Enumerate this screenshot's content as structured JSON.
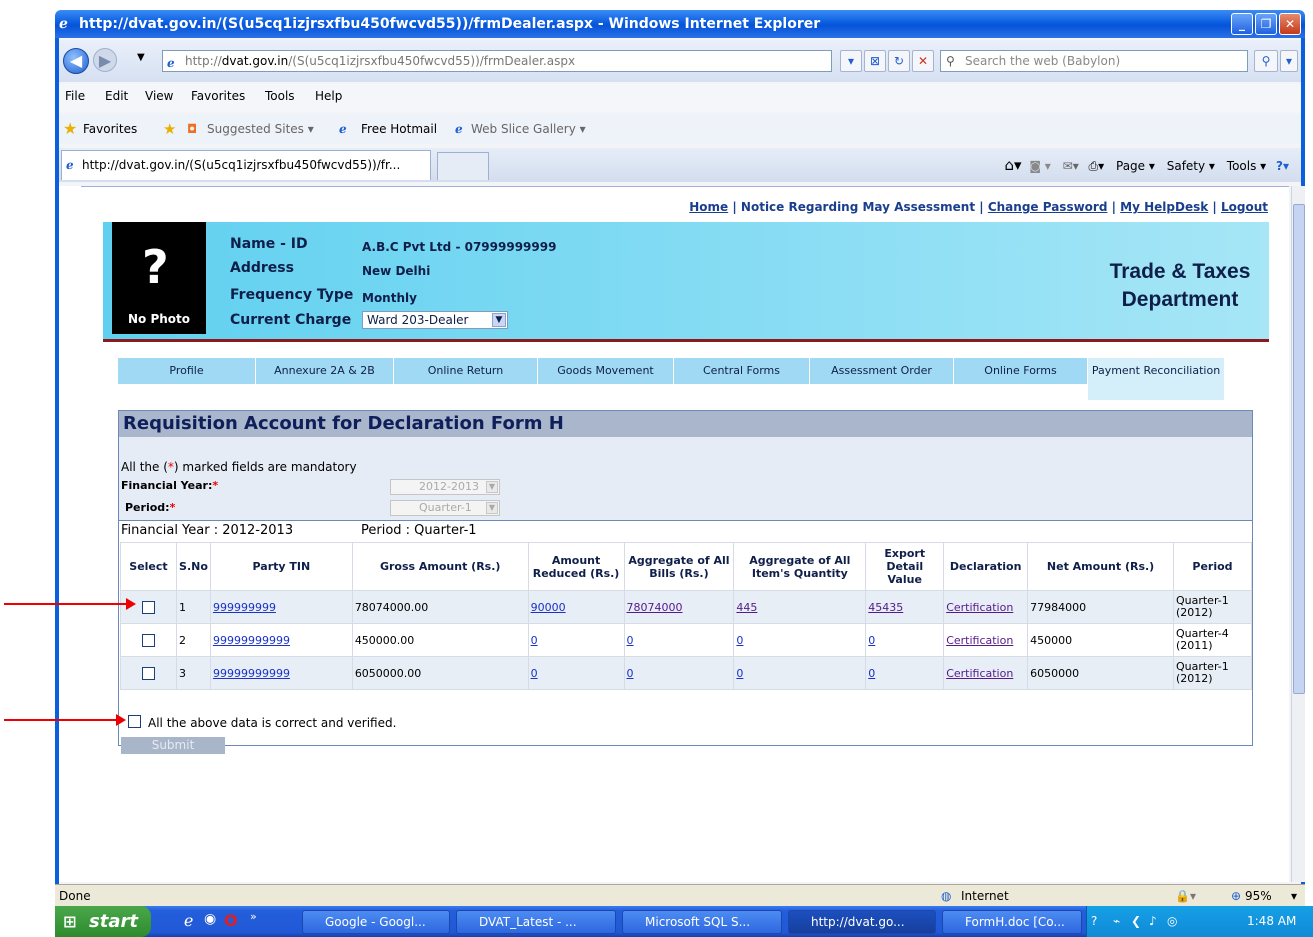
{
  "window": {
    "title": "http://dvat.gov.in/(S(u5cq1izjrsxfbu450fwcvd55))/frmDealer.aspx - Windows Internet Explorer"
  },
  "browser": {
    "address_prefix": "http://",
    "address_domain": "dvat.gov.in",
    "address_rest": "/(S(u5cq1izjrsxfbu450fwcvd55))/frmDealer.aspx",
    "search_placeholder": "Search the web (Babylon)",
    "menu": [
      "File",
      "Edit",
      "View",
      "Favorites",
      "Tools",
      "Help"
    ],
    "favorites": {
      "label": "Favorites",
      "suggested": "Suggested Sites ▾",
      "hotmail": "Free Hotmail",
      "webslice": "Web Slice Gallery ▾"
    },
    "tab_title": "http://dvat.gov.in/(S(u5cq1izjrsxfbu450fwcvd55))/fr...",
    "commands": {
      "page": "Page ▾",
      "safety": "Safety ▾",
      "tools": "Tools ▾"
    }
  },
  "page": {
    "toplinks": [
      "Home",
      "Notice Regarding May Assessment",
      "Change Password",
      "My HelpDesk",
      "Logout"
    ],
    "photo": {
      "mark": "?",
      "label": "No Photo"
    },
    "dealer": {
      "name_label": "Name - ID",
      "name_value": "A.B.C Pvt Ltd - 07999999999",
      "address_label": "Address",
      "address_value": "New Delhi",
      "frequency_label": "Frequency Type",
      "frequency_value": "Monthly",
      "charge_label": "Current Charge",
      "charge_value": "Ward 203-Dealer"
    },
    "department": "Trade & Taxes Department",
    "module_tabs": [
      "Profile",
      "Annexure 2A & 2B",
      "Online Return",
      "Goods Movement",
      "Central Forms",
      "Assessment Order",
      "Online Forms",
      "Payment Reconciliation"
    ],
    "form": {
      "title": "Requisition Account for Declaration Form H",
      "mandatory_note_pre": "All the (",
      "mandatory_star": "*",
      "mandatory_note_post": ") marked fields are mandatory",
      "fy_label": "Financial Year:",
      "fy_value": "2012-2013",
      "period_label": "Period:",
      "period_value": "Quarter-1",
      "summary_fy": "Financial Year : 2012-2013",
      "summary_period": "Period : Quarter-1"
    },
    "table": {
      "headers": [
        "Select",
        "S.No",
        "Party TIN",
        "Gross Amount (Rs.)",
        "Amount Reduced (Rs.)",
        "Aggregate of All Bills (Rs.)",
        "Aggregate of All Item's Quantity",
        "Export Detail Value",
        "Declaration",
        "Net Amount (Rs.)",
        "Period"
      ],
      "rows": [
        {
          "sno": "1",
          "tin": "999999999",
          "gross": "78074000.00",
          "reduced": "90000",
          "bills": "78074000",
          "qty": "445",
          "export": "45435",
          "decl": "Certification",
          "net": "77984000",
          "period": "Quarter-1 (2012)"
        },
        {
          "sno": "2",
          "tin": "99999999999",
          "gross": "450000.00",
          "reduced": "0",
          "bills": "0",
          "qty": "0",
          "export": "0",
          "decl": "Certification",
          "net": "450000",
          "period": "Quarter-4 (2011)"
        },
        {
          "sno": "3",
          "tin": "99999999999",
          "gross": "6050000.00",
          "reduced": "0",
          "bills": "0",
          "qty": "0",
          "export": "0",
          "decl": "Certification",
          "net": "6050000",
          "period": "Quarter-1 (2012)"
        }
      ]
    },
    "verify_text": "All the above data is correct and verified.",
    "submit_label": "Submit"
  },
  "status": {
    "left": "Done",
    "zone": "Internet",
    "zoom": "95%"
  },
  "taskbar": {
    "start": "start",
    "tasks": [
      "Google - Googl...",
      "DVAT_Latest - ...",
      "Microsoft SQL S...",
      "http://dvat.go...",
      "FormH.doc [Co..."
    ],
    "clock": "1:48 AM"
  },
  "colors": {
    "header_blue": "#5fd0f0",
    "panel_head": "#aab6cc",
    "annotation_arrow": "#e00000"
  }
}
